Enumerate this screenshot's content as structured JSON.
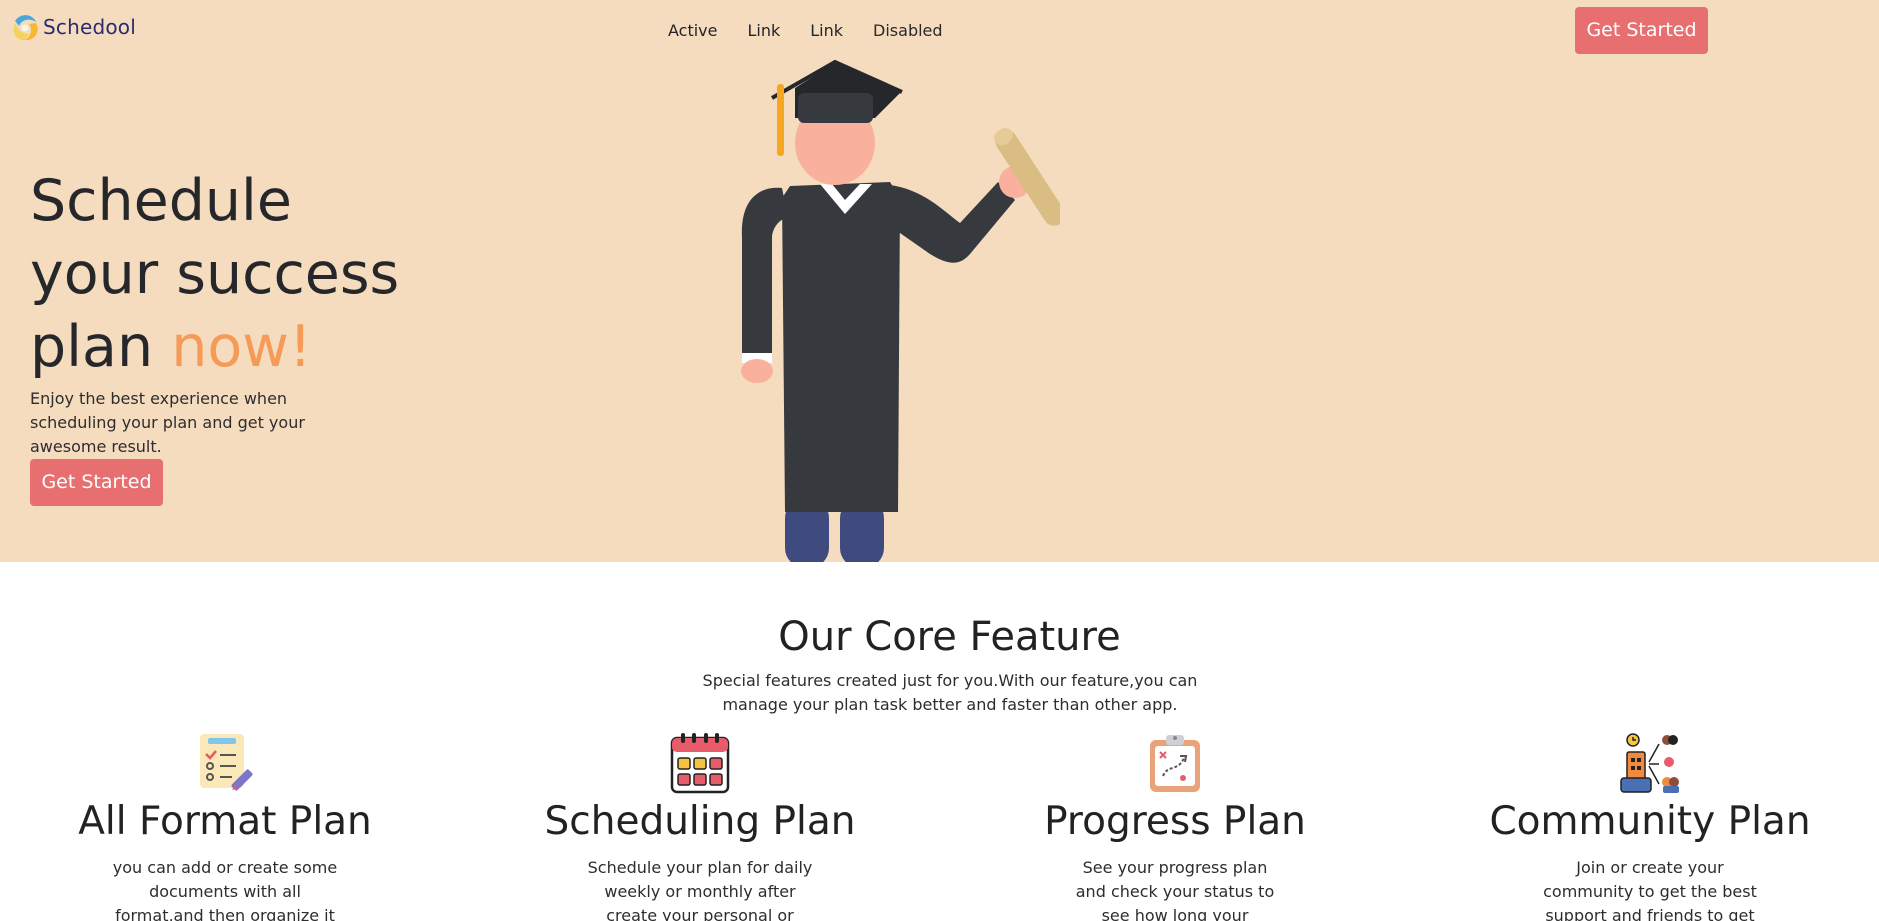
{
  "brand": {
    "name": "Schedool"
  },
  "nav": {
    "items": [
      "Active",
      "Link",
      "Link",
      "Disabled"
    ]
  },
  "header": {
    "cta_label": "Get Started"
  },
  "hero": {
    "headline_line1": "Schedule",
    "headline_line2": "your success",
    "headline_line3_prefix": "plan ",
    "headline_line3_accent": "now!",
    "subtitle": "Enjoy the best experience when scheduling your plan and get your awesome result.",
    "cta_label": "Get Started",
    "illustration": "graduate-illustration"
  },
  "features_section": {
    "title": "Our Core Feature",
    "subtitle": "Special features created just for you.With our feature,you can manage your plan task better and faster than other app.",
    "items": [
      {
        "icon": "checklist-icon",
        "title": "All Format Plan",
        "description": "you can add or create some documents with all format,and then organize it easily"
      },
      {
        "icon": "calendar-icon",
        "title": "Scheduling Plan",
        "description": "Schedule your plan for daily weekly or monthly after create your personal or team plan"
      },
      {
        "icon": "clipboard-strategy-icon",
        "title": "Progress Plan",
        "description": "See your progress plan and check your status to see how long your success program."
      },
      {
        "icon": "community-icon",
        "title": "Community Plan",
        "description": "Join or create your community to get the best support and friends to get motivation."
      }
    ]
  },
  "colors": {
    "hero_bg": "#f5dcbe",
    "accent": "#f59b57",
    "button": "#e76f70",
    "brand_text": "#2b2c6e"
  }
}
